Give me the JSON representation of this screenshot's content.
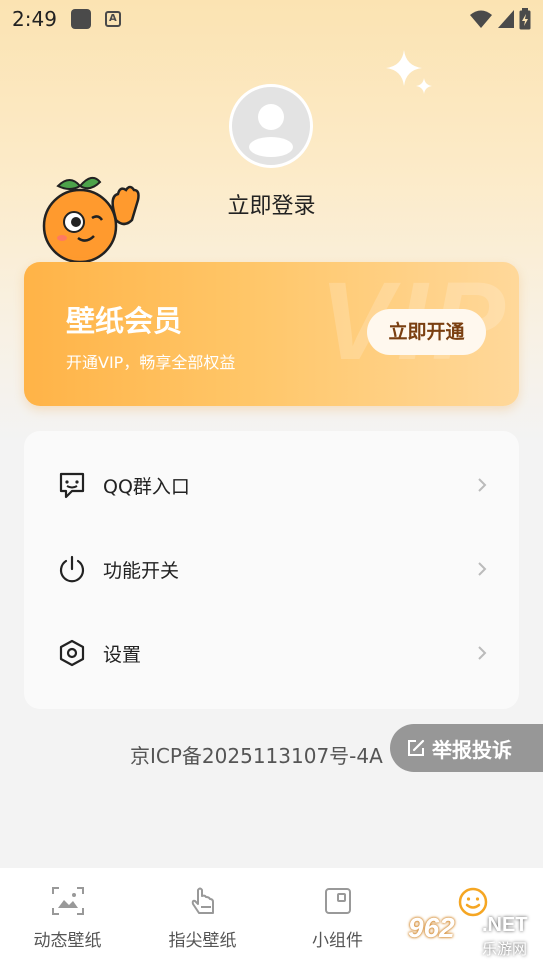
{
  "status_bar": {
    "time": "2:49",
    "a_badge": "A"
  },
  "profile": {
    "login_label": "立即登录"
  },
  "vip": {
    "watermark": "VIP",
    "title": "壁纸会员",
    "subtitle": "开通VIP，畅享全部权益",
    "button_label": "立即开通",
    "colors": {
      "start": "#ffb347",
      "end": "#ffd89a",
      "button_text": "#7a3f10"
    }
  },
  "menu": {
    "items": [
      {
        "label": "QQ群入口",
        "icon": "chat-bubble-icon"
      },
      {
        "label": "功能开关",
        "icon": "power-icon"
      },
      {
        "label": "设置",
        "icon": "hexagon-settings-icon"
      }
    ]
  },
  "footer": {
    "icp": "京ICP备2025113107号-4A",
    "report_label": "举报投诉"
  },
  "tab_bar": {
    "tabs": [
      {
        "label": "动态壁纸",
        "icon": "image-frame-icon"
      },
      {
        "label": "指尖壁纸",
        "icon": "finger-tap-icon"
      },
      {
        "label": "小组件",
        "icon": "widget-icon"
      },
      {
        "label": "",
        "icon": "smiley-icon",
        "active": true
      }
    ]
  },
  "watermark": {
    "number": "962",
    "suffix": ".NET",
    "site_name": "乐游网"
  }
}
